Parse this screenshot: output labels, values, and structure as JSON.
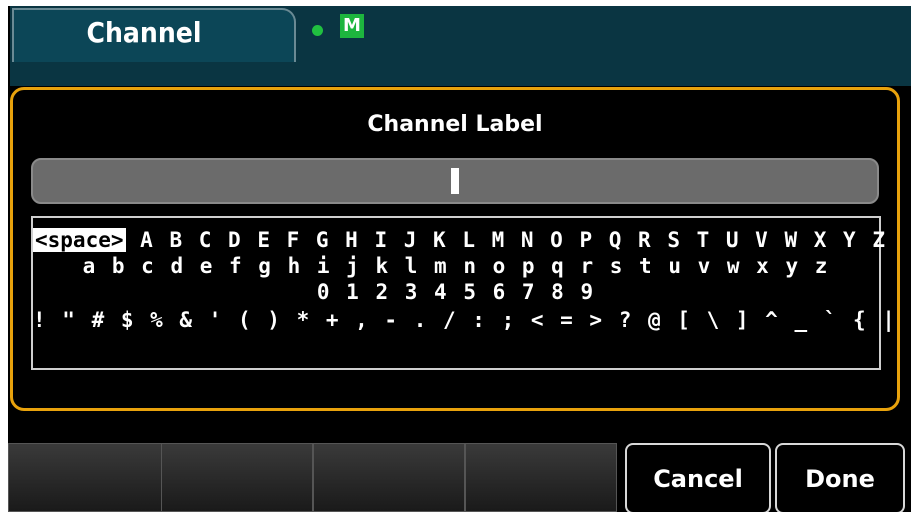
{
  "tab": {
    "label": "Channel"
  },
  "status": {
    "mode_badge": "M",
    "dot_color": "#20c040"
  },
  "dialog": {
    "title": "Channel Label",
    "input_value": "",
    "space_key": "<space>",
    "rows": [
      "A B C D E F G H I J K L M N O P Q R S T U V W X Y Z",
      "a b c d e f g h i j k l m n o p q r s t u v w x y z",
      "0 1 2 3 4 5 6 7 8 9",
      "! \" # $ % & ' ( ) * + , - . / : ; < = > ? @ [ \\ ] ^ _ ` { | } ~"
    ]
  },
  "softkeys": {
    "cancel": "Cancel",
    "done": "Done"
  },
  "colors": {
    "accent": "#e8a20c",
    "topbar": "#0a3542",
    "badge": "#1db53e"
  }
}
